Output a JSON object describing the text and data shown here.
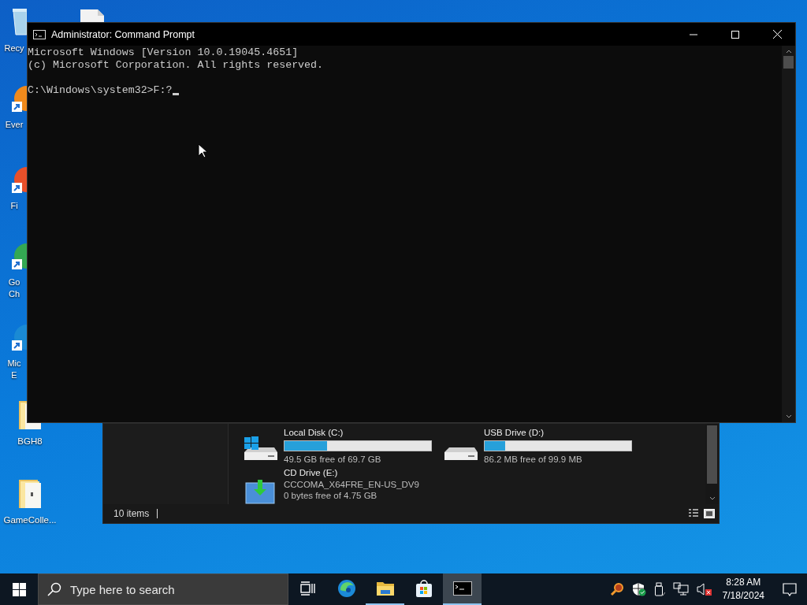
{
  "desktop": {
    "icons": [
      {
        "kind": "recycle-bin",
        "lines": [
          "Recy"
        ]
      },
      {
        "kind": "shortcut",
        "color": "#f08a1c",
        "lines": [
          "Ever"
        ]
      },
      {
        "kind": "shortcut",
        "color": "#e8502a",
        "lines": [
          "Fi"
        ]
      },
      {
        "kind": "shortcut",
        "color": "#34a853",
        "lines": [
          "Go",
          "Ch"
        ]
      },
      {
        "kind": "shortcut",
        "color": "#1a8ad4",
        "lines": [
          "Mic",
          "E"
        ]
      },
      {
        "kind": "folder",
        "lines": [
          "BGH8"
        ]
      },
      {
        "kind": "folder",
        "lines": [
          "GameColle..."
        ]
      },
      {
        "kind": "file"
      }
    ]
  },
  "explorer": {
    "drives": [
      {
        "kind": "windows-disk",
        "name": "Local Disk (C:)",
        "level": 0.29,
        "free": "49.5 GB free of 69.7 GB"
      },
      {
        "kind": "disk",
        "name": "USB Drive (D:)",
        "level": 0.14,
        "free": "86.2 MB free of 99.9 MB"
      },
      {
        "kind": "cd",
        "name": "CD Drive (E:)",
        "label": "CCCOMA_X64FRE_EN-US_DV9",
        "free": "0 bytes free of 4.75 GB"
      }
    ],
    "status": "10 items"
  },
  "console": {
    "title": "Administrator: Command Prompt",
    "lines": [
      "Microsoft Windows [Version 10.0.19045.4651]",
      "(c) Microsoft Corporation. All rights reserved."
    ],
    "prompt": "C:\\Windows\\system32>",
    "input": "F:?"
  },
  "taskbar": {
    "search_placeholder": "Type here to search",
    "apps": [
      {
        "kind": "task-view",
        "running": false,
        "selected": false
      },
      {
        "kind": "edge",
        "running": false,
        "selected": false
      },
      {
        "kind": "explorer",
        "running": true,
        "selected": false
      },
      {
        "kind": "store",
        "running": false,
        "selected": false
      },
      {
        "kind": "console",
        "running": true,
        "selected": true
      }
    ],
    "time": "8:28 AM",
    "date": "7/18/2024"
  }
}
